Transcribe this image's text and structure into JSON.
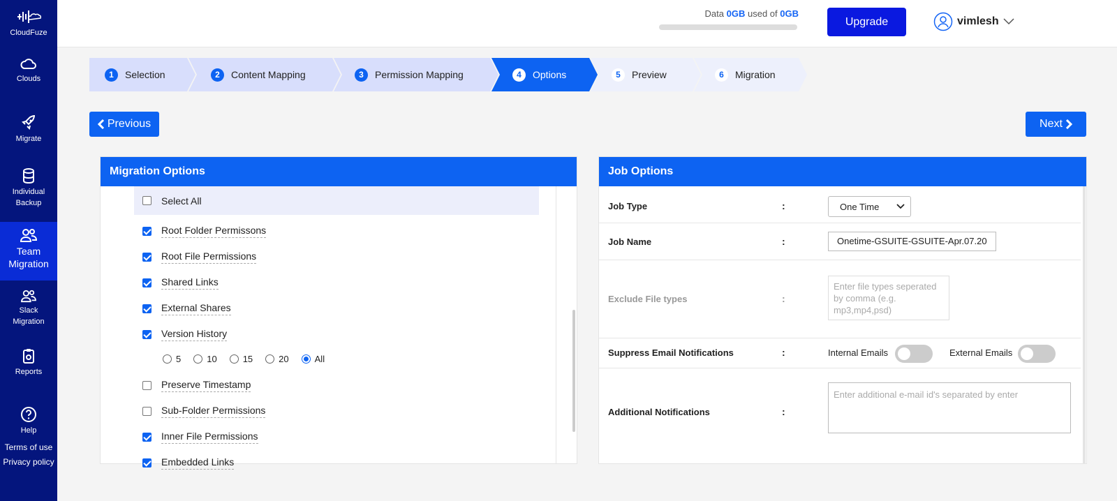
{
  "sidebar": {
    "brand": "CloudFuze",
    "items": [
      {
        "label": "Clouds",
        "icon": "cloud-icon"
      },
      {
        "label": "Migrate",
        "icon": "rocket-icon"
      },
      {
        "label": "Individual Backup",
        "icon": "database-icon"
      },
      {
        "label": "Team Migration",
        "icon": "team-icon"
      },
      {
        "label": "Slack Migration",
        "icon": "team-icon"
      },
      {
        "label": "Reports",
        "icon": "clipboard-icon"
      },
      {
        "label": "Help",
        "icon": "help-icon"
      }
    ],
    "links": [
      "Terms of use",
      "Privacy policy"
    ]
  },
  "header": {
    "usage_prefix": "Data",
    "used": "0GB",
    "usage_mid": "used of",
    "total": "0GB",
    "usage_fraction": 0,
    "upgrade_label": "Upgrade",
    "username": "vimlesh"
  },
  "steps": [
    {
      "num": "1",
      "label": "Selection"
    },
    {
      "num": "2",
      "label": "Content Mapping"
    },
    {
      "num": "3",
      "label": "Permission Mapping"
    },
    {
      "num": "4",
      "label": "Options"
    },
    {
      "num": "5",
      "label": "Preview"
    },
    {
      "num": "6",
      "label": "Migration"
    }
  ],
  "nav": {
    "previous_label": "Previous",
    "next_label": "Next"
  },
  "migration_options": {
    "title": "Migration Options",
    "select_all": "Select All",
    "options": [
      {
        "label": "Root Folder Permissons",
        "checked": true
      },
      {
        "label": "Root File Permissions",
        "checked": true
      },
      {
        "label": "Shared Links",
        "checked": true
      },
      {
        "label": "External Shares",
        "checked": true
      },
      {
        "label": "Version History",
        "checked": true
      },
      {
        "label": "Preserve Timestamp",
        "checked": false
      },
      {
        "label": "Sub-Folder Permissions",
        "checked": false
      },
      {
        "label": "Inner File Permissions",
        "checked": true
      },
      {
        "label": "Embedded Links",
        "checked": true
      }
    ],
    "version_choices": [
      "5",
      "10",
      "15",
      "20",
      "All"
    ],
    "version_selected": "All"
  },
  "job_options": {
    "title": "Job Options",
    "colon": ":",
    "job_type_label": "Job Type",
    "job_type_value": "One Time",
    "job_name_label": "Job Name",
    "job_name_value": "Onetime-GSUITE-GSUITE-Apr.07.20",
    "exclude_label": "Exclude File types",
    "exclude_placeholder": "Enter file types seperated by comma (e.g. mp3,mp4,psd)",
    "suppress_label": "Suppress Email Notifications",
    "internal_emails": "Internal Emails",
    "external_emails": "External Emails",
    "internal_on": false,
    "external_on": false,
    "additional_label": "Additional Notifications",
    "additional_placeholder": "Enter additional e-mail id's separated by enter"
  },
  "colors": {
    "primary": "#0d63f2",
    "sidebar": "#04157d",
    "upgrade": "#0a19e0"
  }
}
